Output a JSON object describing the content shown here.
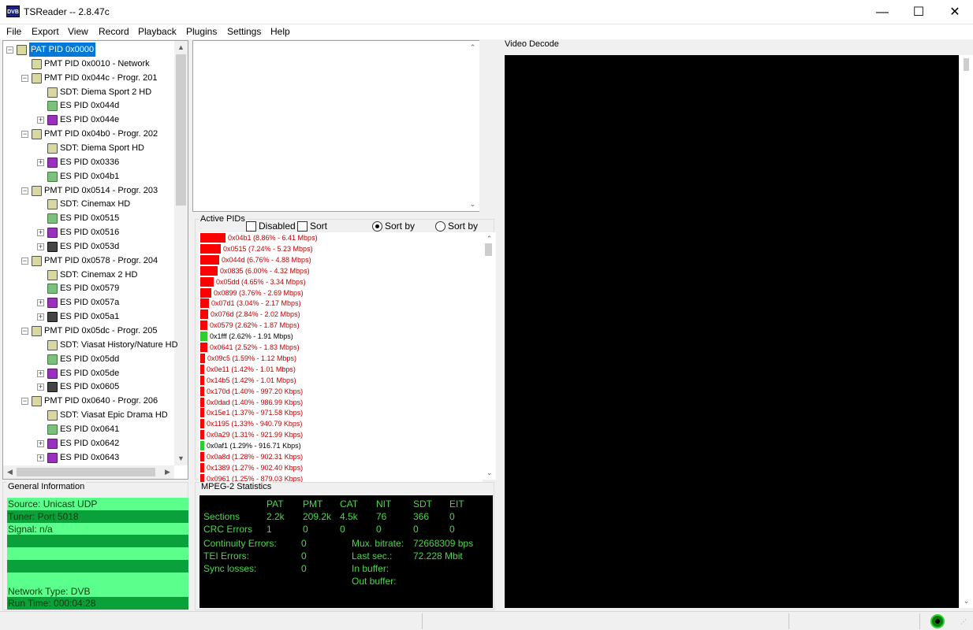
{
  "window": {
    "title": "TSReader -- 2.8.47c",
    "icon_label": "DVB",
    "minimize": "—",
    "maximize": "☐",
    "close": "✕"
  },
  "menu": [
    "File",
    "Export",
    "View",
    "Record",
    "Playback",
    "Plugins",
    "Settings",
    "Help"
  ],
  "tree": {
    "items": [
      {
        "label": "PAT PID 0x0000",
        "type": "pat",
        "level": 0,
        "expander": "-",
        "selected": true
      },
      {
        "label": "PMT PID 0x0010 - Network",
        "type": "pat",
        "level": 1,
        "expander": ""
      },
      {
        "label": "PMT PID 0x044c - Progr. 201",
        "type": "pat",
        "level": 1,
        "expander": "-"
      },
      {
        "label": "SDT: Diema Sport 2 HD",
        "type": "sdt",
        "level": 2,
        "expander": ""
      },
      {
        "label": "ES PID 0x044d",
        "type": "es",
        "level": 2,
        "expander": ""
      },
      {
        "label": "ES PID 0x044e",
        "type": "audio",
        "level": 2,
        "expander": "+"
      },
      {
        "label": "PMT PID 0x04b0 - Progr. 202",
        "type": "pat",
        "level": 1,
        "expander": "-"
      },
      {
        "label": "SDT: Diema Sport HD",
        "type": "sdt",
        "level": 2,
        "expander": ""
      },
      {
        "label": "ES PID 0x0336",
        "type": "audio",
        "level": 2,
        "expander": "+"
      },
      {
        "label": "ES PID 0x04b1",
        "type": "es",
        "level": 2,
        "expander": ""
      },
      {
        "label": "PMT PID 0x0514 - Progr. 203",
        "type": "pat",
        "level": 1,
        "expander": "-"
      },
      {
        "label": "SDT: Cinemax HD",
        "type": "sdt",
        "level": 2,
        "expander": ""
      },
      {
        "label": "ES PID 0x0515",
        "type": "es",
        "level": 2,
        "expander": ""
      },
      {
        "label": "ES PID 0x0516",
        "type": "audio",
        "level": 2,
        "expander": "+"
      },
      {
        "label": "ES PID 0x053d",
        "type": "video",
        "level": 2,
        "expander": "+"
      },
      {
        "label": "PMT PID 0x0578 - Progr. 204",
        "type": "pat",
        "level": 1,
        "expander": "-"
      },
      {
        "label": "SDT: Cinemax 2 HD",
        "type": "sdt",
        "level": 2,
        "expander": ""
      },
      {
        "label": "ES PID 0x0579",
        "type": "es",
        "level": 2,
        "expander": ""
      },
      {
        "label": "ES PID 0x057a",
        "type": "audio",
        "level": 2,
        "expander": "+"
      },
      {
        "label": "ES PID 0x05a1",
        "type": "video",
        "level": 2,
        "expander": "+"
      },
      {
        "label": "PMT PID 0x05dc - Progr. 205",
        "type": "pat",
        "level": 1,
        "expander": "-"
      },
      {
        "label": "SDT: Viasat History/Nature HD",
        "type": "sdt",
        "level": 2,
        "expander": ""
      },
      {
        "label": "ES PID 0x05dd",
        "type": "es",
        "level": 2,
        "expander": ""
      },
      {
        "label": "ES PID 0x05de",
        "type": "audio",
        "level": 2,
        "expander": "+"
      },
      {
        "label": "ES PID 0x0605",
        "type": "video",
        "level": 2,
        "expander": "+"
      },
      {
        "label": "PMT PID 0x0640 - Progr. 206",
        "type": "pat",
        "level": 1,
        "expander": "-"
      },
      {
        "label": "SDT: Viasat Epic Drama HD",
        "type": "sdt",
        "level": 2,
        "expander": ""
      },
      {
        "label": "ES PID 0x0641",
        "type": "es",
        "level": 2,
        "expander": ""
      },
      {
        "label": "ES PID 0x0642",
        "type": "audio",
        "level": 2,
        "expander": "+"
      },
      {
        "label": "ES PID 0x0643",
        "type": "audio",
        "level": 2,
        "expander": "+"
      }
    ]
  },
  "general_info": {
    "title": "General Information",
    "rows": [
      {
        "text": "Source: Unicast UDP",
        "shade": "light"
      },
      {
        "text": "Tuner: Port 5018",
        "shade": "dark"
      },
      {
        "text": "Signal: n/a",
        "shade": "light"
      },
      {
        "text": "",
        "shade": "dark"
      },
      {
        "text": "",
        "shade": "light"
      },
      {
        "text": "",
        "shade": "dark"
      },
      {
        "text": "",
        "shade": "light"
      },
      {
        "text": "Network Type: DVB",
        "shade": "light"
      },
      {
        "text": "Run Time: 000:04:28",
        "shade": "dark"
      }
    ]
  },
  "active_pids": {
    "title": "Active PIDs",
    "disabled_label": "Disabled",
    "sort_desc_label": "Sort Decending",
    "sort_rate_label": "Sort by Rate",
    "sort_pid_label": "Sort by PID",
    "rows": [
      {
        "text": "0x04b1 (8.86% - 6.41 Mbps)",
        "pct": 8.86,
        "color": "#ff0000"
      },
      {
        "text": "0x0515 (7.24% - 5.23 Mbps)",
        "pct": 7.24,
        "color": "#ff0000"
      },
      {
        "text": "0x044d (6.76% - 4.88 Mbps)",
        "pct": 6.76,
        "color": "#ff0000"
      },
      {
        "text": "0x0835 (6.00% - 4.32 Mbps)",
        "pct": 6.0,
        "color": "#ff0000"
      },
      {
        "text": "0x05dd (4.65% - 3.34 Mbps)",
        "pct": 4.65,
        "color": "#ff0000"
      },
      {
        "text": "0x0899 (3.76% - 2.69 Mbps)",
        "pct": 3.76,
        "color": "#ff0000"
      },
      {
        "text": "0x07d1 (3.04% - 2.17 Mbps)",
        "pct": 3.04,
        "color": "#ff0000"
      },
      {
        "text": "0x076d (2.84% - 2.02 Mbps)",
        "pct": 2.84,
        "color": "#ff0000"
      },
      {
        "text": "0x0579 (2.62% - 1.87 Mbps)",
        "pct": 2.62,
        "color": "#ff0000"
      },
      {
        "text": "0x1fff (2.62% - 1.91 Mbps)",
        "pct": 2.62,
        "color": "#2ecc2e"
      },
      {
        "text": "0x0641 (2.52% - 1.83 Mbps)",
        "pct": 2.52,
        "color": "#ff0000"
      },
      {
        "text": "0x09c5 (1.59% - 1.12 Mbps)",
        "pct": 1.59,
        "color": "#ff0000"
      },
      {
        "text": "0x0e11 (1.42% - 1.01 Mbps)",
        "pct": 1.42,
        "color": "#ff0000"
      },
      {
        "text": "0x14b5 (1.42% - 1.01 Mbps)",
        "pct": 1.42,
        "color": "#ff0000"
      },
      {
        "text": "0x170d (1.40% - 997.20 Kbps)",
        "pct": 1.4,
        "color": "#ff0000"
      },
      {
        "text": "0x0dad (1.40% - 986.99 Kbps)",
        "pct": 1.4,
        "color": "#ff0000"
      },
      {
        "text": "0x15e1 (1.37% - 971.58 Kbps)",
        "pct": 1.37,
        "color": "#ff0000"
      },
      {
        "text": "0x1195 (1.33% - 940.79 Kbps)",
        "pct": 1.33,
        "color": "#ff0000"
      },
      {
        "text": "0x0a29 (1.31% - 921.99 Kbps)",
        "pct": 1.31,
        "color": "#ff0000"
      },
      {
        "text": "0x0af1 (1.29% - 916.71 Kbps)",
        "pct": 1.29,
        "color": "#2ecc2e"
      },
      {
        "text": "0x0a8d (1.28% - 902.31 Kbps)",
        "pct": 1.28,
        "color": "#ff0000"
      },
      {
        "text": "0x1389 (1.27% - 902.40 Kbps)",
        "pct": 1.27,
        "color": "#ff0000"
      },
      {
        "text": "0x0961 (1.25% - 879.03 Kbps)",
        "pct": 1.25,
        "color": "#ff0000"
      }
    ]
  },
  "mpeg_stats": {
    "title": "MPEG-2 Statistics",
    "headers": [
      "PAT",
      "PMT",
      "CAT",
      "NIT",
      "SDT",
      "EIT"
    ],
    "sections_label": "Sections",
    "sections": [
      "2.2k",
      "209.2k",
      "4.5k",
      "76",
      "366",
      "0"
    ],
    "crc_label": "CRC Errors",
    "crc": [
      "1",
      "0",
      "0",
      "0",
      "0",
      "0"
    ],
    "continuity_label": "Continuity Errors:",
    "continuity": "0",
    "tei_label": "TEI Errors:",
    "tei": "0",
    "sync_label": "Sync losses:",
    "sync": "0",
    "mux_label": "Mux. bitrate:",
    "mux": "72668309 bps",
    "last_label": "Last sec.:",
    "last": "72.228 Mbit",
    "inbuf_label": "In buffer:",
    "outbuf_label": "Out buffer:"
  },
  "video": {
    "title": "Video Decode"
  }
}
